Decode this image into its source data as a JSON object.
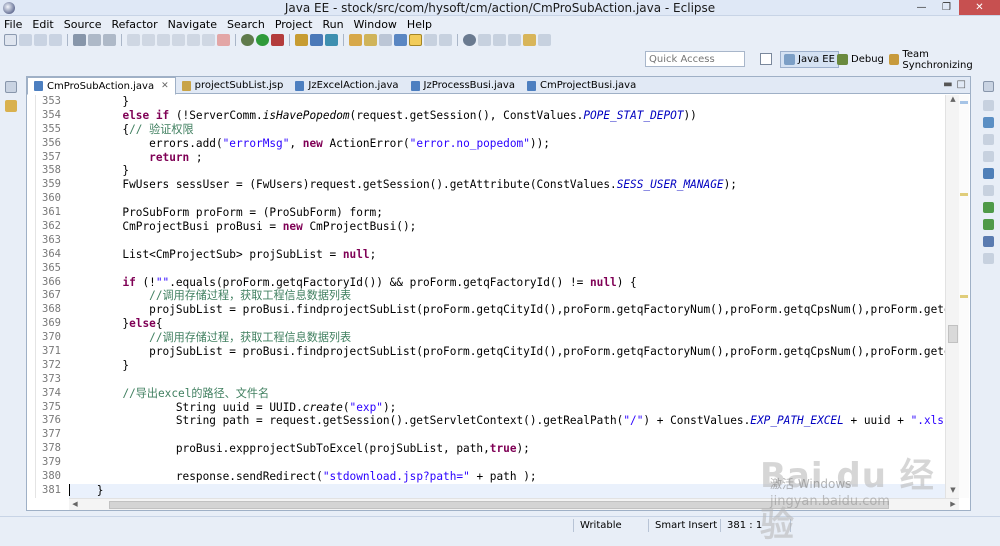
{
  "window": {
    "title": "Java EE - stock/src/com/hysoft/cm/action/CmProSubAction.java - Eclipse"
  },
  "menu": [
    "File",
    "Edit",
    "Source",
    "Refactor",
    "Navigate",
    "Search",
    "Project",
    "Run",
    "Window",
    "Help"
  ],
  "quick_access": {
    "placeholder": "Quick Access"
  },
  "perspectives": [
    {
      "label": "Java EE",
      "active": true,
      "icon": "java-ee-perspective-icon"
    },
    {
      "label": "Debug",
      "active": false,
      "icon": "bug-icon"
    },
    {
      "label": "Team Synchronizing",
      "active": false,
      "icon": "team-sync-icon"
    }
  ],
  "tabs": [
    {
      "label": "CmProSubAction.java",
      "active": true,
      "type": "java"
    },
    {
      "label": "projectSubList.jsp",
      "active": false,
      "type": "jsp"
    },
    {
      "label": "JzExcelAction.java",
      "active": false,
      "type": "java"
    },
    {
      "label": "JzProcessBusi.java",
      "active": false,
      "type": "java"
    },
    {
      "label": "CmProjectBusi.java",
      "active": false,
      "type": "java"
    }
  ],
  "code_lines": [
    {
      "num": "353",
      "tokens": [
        {
          "t": "        }",
          "c": ""
        }
      ]
    },
    {
      "num": "354",
      "tokens": [
        {
          "t": "        ",
          "c": ""
        },
        {
          "t": "else if",
          "c": "kw"
        },
        {
          "t": " (!ServerComm.",
          "c": ""
        },
        {
          "t": "isHavePopedom",
          "c": "mi"
        },
        {
          "t": "(request.getSession(), ConstValues.",
          "c": ""
        },
        {
          "t": "POPE_STAT_DEPOT",
          "c": "it"
        },
        {
          "t": "))",
          "c": ""
        }
      ]
    },
    {
      "num": "355",
      "tokens": [
        {
          "t": "        {",
          "c": ""
        },
        {
          "t": "// 验证权限",
          "c": "cm"
        }
      ]
    },
    {
      "num": "356",
      "tokens": [
        {
          "t": "            errors.add(",
          "c": ""
        },
        {
          "t": "\"errorMsg\"",
          "c": "str"
        },
        {
          "t": ", ",
          "c": ""
        },
        {
          "t": "new",
          "c": "kw"
        },
        {
          "t": " ActionError(",
          "c": ""
        },
        {
          "t": "\"error.no_popedom\"",
          "c": "str"
        },
        {
          "t": "));",
          "c": ""
        }
      ]
    },
    {
      "num": "357",
      "tokens": [
        {
          "t": "            ",
          "c": ""
        },
        {
          "t": "return",
          "c": "kw"
        },
        {
          "t": " ;",
          "c": ""
        }
      ]
    },
    {
      "num": "358",
      "tokens": [
        {
          "t": "        }",
          "c": ""
        }
      ]
    },
    {
      "num": "359",
      "tokens": [
        {
          "t": "        FwUsers sessUser = (FwUsers)request.getSession().getAttribute(ConstValues.",
          "c": ""
        },
        {
          "t": "SESS_USER_MANAGE",
          "c": "it"
        },
        {
          "t": ");",
          "c": ""
        }
      ]
    },
    {
      "num": "360",
      "tokens": []
    },
    {
      "num": "361",
      "tokens": [
        {
          "t": "        ProSubForm proForm = (ProSubForm) form;",
          "c": ""
        }
      ]
    },
    {
      "num": "362",
      "tokens": [
        {
          "t": "        CmProjectBusi proBusi = ",
          "c": ""
        },
        {
          "t": "new",
          "c": "kw"
        },
        {
          "t": " CmProjectBusi();",
          "c": ""
        }
      ]
    },
    {
      "num": "363",
      "tokens": []
    },
    {
      "num": "364",
      "tokens": [
        {
          "t": "        List<CmProjectSub> projSubList = ",
          "c": ""
        },
        {
          "t": "null",
          "c": "kw"
        },
        {
          "t": ";",
          "c": ""
        }
      ]
    },
    {
      "num": "365",
      "tokens": []
    },
    {
      "num": "366",
      "tokens": [
        {
          "t": "        ",
          "c": ""
        },
        {
          "t": "if",
          "c": "kw"
        },
        {
          "t": " (!",
          "c": ""
        },
        {
          "t": "\"\"",
          "c": "str"
        },
        {
          "t": ".equals(proForm.getqFactoryId()) && proForm.getqFactoryId() != ",
          "c": ""
        },
        {
          "t": "null",
          "c": "kw"
        },
        {
          "t": ") {",
          "c": ""
        }
      ]
    },
    {
      "num": "367",
      "tokens": [
        {
          "t": "            ",
          "c": ""
        },
        {
          "t": "//调用存储过程，获取工程信息数据列表",
          "c": "cm"
        }
      ]
    },
    {
      "num": "368",
      "tokens": [
        {
          "t": "            projSubList = proBusi.findprojectSubList(proForm.getqCityId(),proForm.getqFactoryNum(),proForm.getqCpsNum(),proForm.getqC",
          "c": ""
        }
      ]
    },
    {
      "num": "369",
      "tokens": [
        {
          "t": "        }",
          "c": ""
        },
        {
          "t": "else",
          "c": "kw"
        },
        {
          "t": "{",
          "c": ""
        }
      ]
    },
    {
      "num": "370",
      "tokens": [
        {
          "t": "            ",
          "c": ""
        },
        {
          "t": "//调用存储过程，获取工程信息数据列表",
          "c": "cm"
        }
      ]
    },
    {
      "num": "371",
      "tokens": [
        {
          "t": "            projSubList = proBusi.findprojectSubList(proForm.getqCityId(),proForm.getqFactoryNum(),proForm.getqCpsNum(),proForm.getqC",
          "c": ""
        }
      ]
    },
    {
      "num": "372",
      "tokens": [
        {
          "t": "        }",
          "c": ""
        }
      ]
    },
    {
      "num": "373",
      "tokens": []
    },
    {
      "num": "374",
      "tokens": [
        {
          "t": "        ",
          "c": ""
        },
        {
          "t": "//导出excel的路径、文件名",
          "c": "cm"
        }
      ]
    },
    {
      "num": "375",
      "tokens": [
        {
          "t": "                String uuid = UUID.",
          "c": ""
        },
        {
          "t": "create",
          "c": "mi"
        },
        {
          "t": "(",
          "c": ""
        },
        {
          "t": "\"exp\"",
          "c": "str"
        },
        {
          "t": ");",
          "c": ""
        }
      ]
    },
    {
      "num": "376",
      "tokens": [
        {
          "t": "                String path = request.getSession().getServletContext().getRealPath(",
          "c": ""
        },
        {
          "t": "\"/\"",
          "c": "str"
        },
        {
          "t": ") + ConstValues.",
          "c": ""
        },
        {
          "t": "EXP_PATH_EXCEL",
          "c": "it"
        },
        {
          "t": " + uuid + ",
          "c": ""
        },
        {
          "t": "\".xls\"",
          "c": "str"
        },
        {
          "t": ";",
          "c": ""
        }
      ]
    },
    {
      "num": "377",
      "tokens": []
    },
    {
      "num": "378",
      "tokens": [
        {
          "t": "                proBusi.expprojectSubToExcel(projSubList, path,",
          "c": ""
        },
        {
          "t": "true",
          "c": "kw"
        },
        {
          "t": ");",
          "c": ""
        }
      ]
    },
    {
      "num": "379",
      "tokens": []
    },
    {
      "num": "380",
      "tokens": [
        {
          "t": "                response.sendRedirect(",
          "c": ""
        },
        {
          "t": "\"stdownload.jsp?path=\"",
          "c": "str"
        },
        {
          "t": " + path );",
          "c": ""
        }
      ]
    },
    {
      "num": "381",
      "tokens": [
        {
          "t": "    }",
          "c": ""
        }
      ],
      "current": true
    }
  ],
  "status": {
    "writable": "Writable",
    "insert_mode": "Smart Insert",
    "position": "381 : 1"
  },
  "watermark": {
    "logo": "Bai du 经验",
    "activate": "激活 Windows",
    "url": "jingyan.baidu.com"
  },
  "colors": {
    "keyword": "#7f0055",
    "string": "#2a00ff",
    "comment": "#3f7f5f",
    "constant": "#0000c0",
    "chrome": "#e8eef7"
  }
}
